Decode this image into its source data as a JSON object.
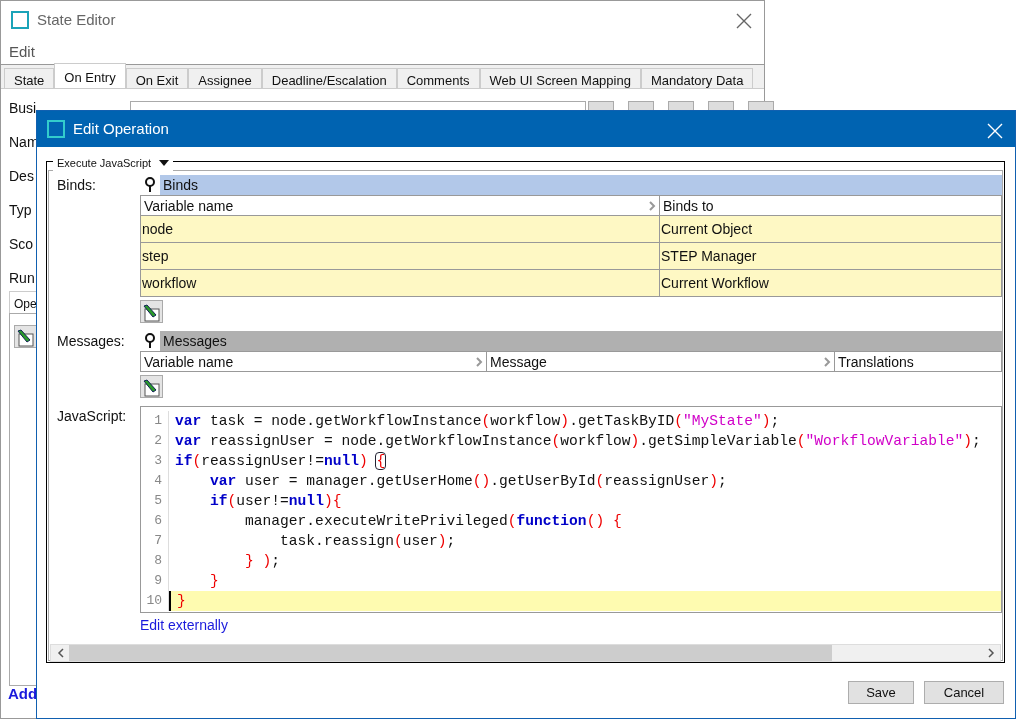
{
  "background_window": {
    "title": "State Editor",
    "menu": [
      "Edit"
    ],
    "tabs": [
      {
        "label": "State",
        "selected": false
      },
      {
        "label": "On Entry",
        "selected": true
      },
      {
        "label": "On Exit",
        "selected": false
      },
      {
        "label": "Assignee",
        "selected": false
      },
      {
        "label": "Deadline/Escalation",
        "selected": false
      },
      {
        "label": "Comments",
        "selected": false
      },
      {
        "label": "Web UI Screen Mapping",
        "selected": false
      },
      {
        "label": "Mandatory Data",
        "selected": false
      }
    ],
    "field_labels": [
      "Busi",
      "Nam",
      "Des",
      "Typ",
      "Sco",
      "Run"
    ],
    "sub_tab": "Ope",
    "add_link": "Add"
  },
  "dialog": {
    "title": "Edit Operation",
    "operation_type": "Execute JavaScript",
    "binds": {
      "label": "Binds:",
      "header": "Binds",
      "selected": true,
      "columns": [
        "Variable name",
        "Binds to"
      ],
      "rows": [
        [
          "node",
          "Current Object"
        ],
        [
          "step",
          "STEP Manager"
        ],
        [
          "workflow",
          "Current Workflow"
        ]
      ]
    },
    "messages": {
      "label": "Messages:",
      "header": "Messages",
      "selected": false,
      "columns": [
        "Variable name",
        "Message",
        "Translations"
      ]
    },
    "javascript": {
      "label": "JavaScript:",
      "lines": [
        {
          "number": "1",
          "current": false,
          "tokens": [
            {
              "kind": "keyword",
              "text": "var"
            },
            {
              "kind": "plain",
              "text": " task = node.getWorkflowInstance"
            },
            {
              "kind": "paren",
              "text": "("
            },
            {
              "kind": "plain",
              "text": "workflow"
            },
            {
              "kind": "paren",
              "text": ")"
            },
            {
              "kind": "plain",
              "text": ".getTaskByID"
            },
            {
              "kind": "paren",
              "text": "("
            },
            {
              "kind": "string",
              "text": "\"MyState\""
            },
            {
              "kind": "paren",
              "text": ")"
            },
            {
              "kind": "plain",
              "text": ";"
            }
          ]
        },
        {
          "number": "2",
          "current": false,
          "tokens": [
            {
              "kind": "keyword",
              "text": "var"
            },
            {
              "kind": "plain",
              "text": " reassignUser = node.getWorkflowInstance"
            },
            {
              "kind": "paren",
              "text": "("
            },
            {
              "kind": "plain",
              "text": "workflow"
            },
            {
              "kind": "paren",
              "text": ")"
            },
            {
              "kind": "plain",
              "text": ".getSimpleVariable"
            },
            {
              "kind": "paren",
              "text": "("
            },
            {
              "kind": "string",
              "text": "\"WorkflowVariable\""
            },
            {
              "kind": "paren",
              "text": ")"
            },
            {
              "kind": "plain",
              "text": ";"
            }
          ]
        },
        {
          "number": "3",
          "current": false,
          "tokens": [
            {
              "kind": "keyword",
              "text": "if"
            },
            {
              "kind": "paren",
              "text": "("
            },
            {
              "kind": "plain",
              "text": "reassignUser!="
            },
            {
              "kind": "keyword",
              "text": "null"
            },
            {
              "kind": "paren",
              "text": ") "
            },
            {
              "kind": "match",
              "text": "{"
            }
          ]
        },
        {
          "number": "4",
          "current": false,
          "tokens": [
            {
              "kind": "keyword",
              "text": "    var"
            },
            {
              "kind": "plain",
              "text": " user = manager.getUserHome"
            },
            {
              "kind": "paren",
              "text": "()"
            },
            {
              "kind": "plain",
              "text": ".getUserById"
            },
            {
              "kind": "paren",
              "text": "("
            },
            {
              "kind": "plain",
              "text": "reassignUser"
            },
            {
              "kind": "paren",
              "text": ")"
            },
            {
              "kind": "plain",
              "text": ";"
            }
          ]
        },
        {
          "number": "5",
          "current": false,
          "tokens": [
            {
              "kind": "keyword",
              "text": "    if"
            },
            {
              "kind": "paren",
              "text": "("
            },
            {
              "kind": "plain",
              "text": "user!="
            },
            {
              "kind": "keyword",
              "text": "null"
            },
            {
              "kind": "paren",
              "text": "){"
            }
          ]
        },
        {
          "number": "6",
          "current": false,
          "tokens": [
            {
              "kind": "plain",
              "text": "        manager.executeWritePrivileged"
            },
            {
              "kind": "paren",
              "text": "("
            },
            {
              "kind": "keyword",
              "text": "function"
            },
            {
              "kind": "paren",
              "text": "() {"
            }
          ]
        },
        {
          "number": "7",
          "current": false,
          "tokens": [
            {
              "kind": "plain",
              "text": "            task.reassign"
            },
            {
              "kind": "paren",
              "text": "("
            },
            {
              "kind": "plain",
              "text": "user"
            },
            {
              "kind": "paren",
              "text": ")"
            },
            {
              "kind": "plain",
              "text": ";"
            }
          ]
        },
        {
          "number": "8",
          "current": false,
          "tokens": [
            {
              "kind": "paren",
              "text": "        } )"
            },
            {
              "kind": "plain",
              "text": ";"
            }
          ]
        },
        {
          "number": "9",
          "current": false,
          "tokens": [
            {
              "kind": "paren",
              "text": "    }"
            }
          ]
        },
        {
          "number": "10",
          "current": true,
          "tokens": [
            {
              "kind": "paren",
              "text": "}"
            }
          ]
        }
      ]
    },
    "edit_link": "Edit externally",
    "buttons": [
      "Save",
      "Cancel"
    ]
  }
}
